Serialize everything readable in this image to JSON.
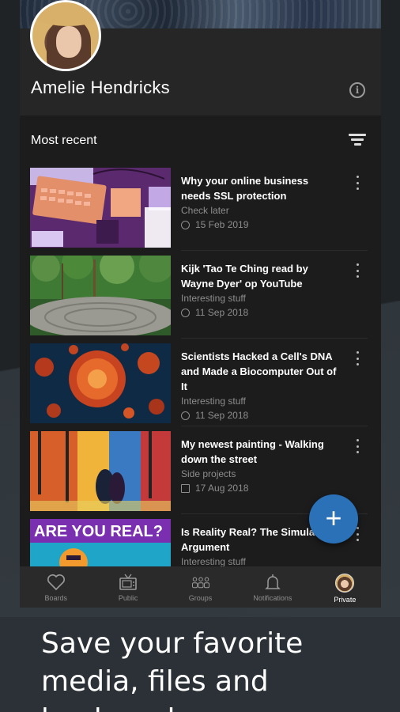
{
  "profile": {
    "name": "Amelie Hendricks",
    "info_icon": "info-icon"
  },
  "section": {
    "title": "Most recent",
    "filter_icon": "filter-icon"
  },
  "items": [
    {
      "title": "Why your online business needs SSL protection",
      "board": "Check later",
      "date": "15 Feb 2019",
      "date_icon": "clock-icon"
    },
    {
      "title": "Kijk 'Tao Te Ching read by Wayne Dyer' op YouTube",
      "board": "Interesting stuff",
      "date": "11 Sep 2018",
      "date_icon": "clock-icon"
    },
    {
      "title": "Scientists Hacked a Cell's DNA and Made a Biocomputer Out of It",
      "board": "Interesting stuff",
      "date": "11 Sep 2018",
      "date_icon": "clock-icon"
    },
    {
      "title": "My newest painting - Walking down the street",
      "board": "Side projects",
      "date": "17 Aug 2018",
      "date_icon": "calendar-icon"
    },
    {
      "title": "Is Reality Real? The Simulation Argument",
      "board": "Interesting stuff",
      "thumb_text": "ARE YOU REAL?"
    }
  ],
  "fab": {
    "label": "+"
  },
  "nav": [
    {
      "label": "Boards",
      "icon": "heart-icon"
    },
    {
      "label": "Public",
      "icon": "tv-icon"
    },
    {
      "label": "Groups",
      "icon": "groups-icon"
    },
    {
      "label": "Notifications",
      "icon": "bell-icon"
    },
    {
      "label": "Private",
      "icon": "avatar-icon",
      "active": true
    }
  ],
  "tagline": "Save your favorite media, files and bookmarks",
  "colors": {
    "accent": "#2a71b8",
    "card": "#1c1c1c",
    "nav": "#2a2a2a"
  }
}
